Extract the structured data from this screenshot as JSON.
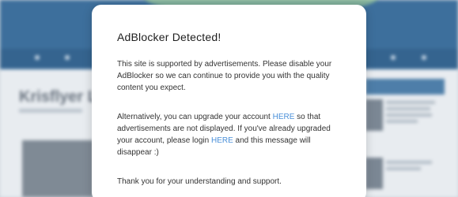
{
  "background": {
    "article_title": "Krisflyer La"
  },
  "modal": {
    "title": "AdBlocker Detected!",
    "paragraph1": "This site is supported by advertisements. Please disable your AdBlocker so we can continue to provide you with the quality content you expect.",
    "paragraph2_part1": "Alternatively, you can upgrade your account ",
    "upgrade_link": "HERE",
    "paragraph2_part2": " so that advertisements are not displayed. If you've already upgraded your account, please login ",
    "login_link": "HERE",
    "paragraph2_part3": " and this message will disappear :)",
    "paragraph3": "Thank you for your understanding and support."
  },
  "colors": {
    "link": "#4a90d9",
    "header": "#3d6f9c"
  }
}
